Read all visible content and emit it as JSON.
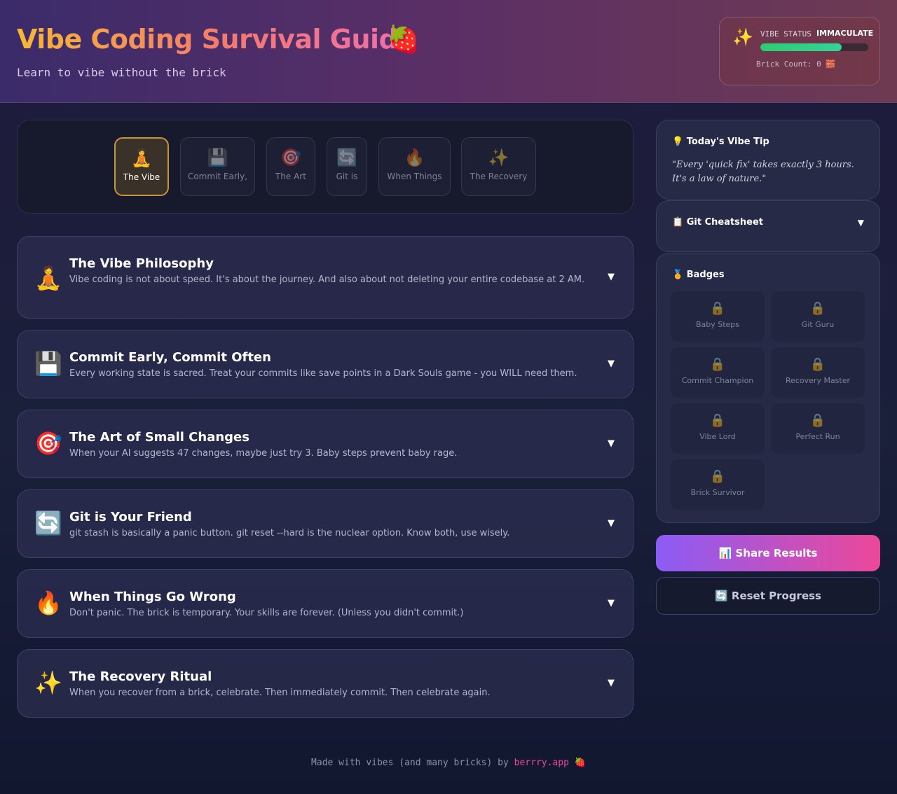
{
  "header": {
    "title": "Vibe Coding Survival Guide",
    "title_emoji": "🍓",
    "subtitle": "Learn to vibe without the brick",
    "status": {
      "icon": "✨",
      "label": "VIBE STATUS",
      "value": "IMMACULATE",
      "level": 0.75,
      "brick_count": "Brick Count: 0 🧱"
    }
  },
  "tabs": [
    {
      "icon": "🧘",
      "label": "The Vibe",
      "active": true
    },
    {
      "icon": "💾",
      "label": "Commit Early,",
      "active": false
    },
    {
      "icon": "🎯",
      "label": "The Art",
      "active": false
    },
    {
      "icon": "🔄",
      "label": "Git is",
      "active": false
    },
    {
      "icon": "🔥",
      "label": "When Things",
      "active": false
    },
    {
      "icon": "✨",
      "label": "The Recovery",
      "active": false
    }
  ],
  "sections": [
    {
      "icon": "🧘",
      "title": "The Vibe Philosophy",
      "desc": "Vibe coding is not about speed. It's about the journey. And also about not deleting your entire codebase at 2 AM.",
      "chevron": "▼"
    },
    {
      "icon": "💾",
      "title": "Commit Early, Commit Often",
      "desc": "Every working state is sacred. Treat your commits like save points in a Dark Souls game - you WILL need them.",
      "chevron": "▼"
    },
    {
      "icon": "🎯",
      "title": "The Art of Small Changes",
      "desc": "When your AI suggests 47 changes, maybe just try 3. Baby steps prevent baby rage.",
      "chevron": "▼"
    },
    {
      "icon": "🔄",
      "title": "Git is Your Friend",
      "desc": "git stash is basically a panic button. git reset --hard is the nuclear option. Know both, use wisely.",
      "chevron": "▼"
    },
    {
      "icon": "🔥",
      "title": "When Things Go Wrong",
      "desc": "Don't panic. The brick is temporary. Your skills are forever. (Unless you didn't commit.)",
      "chevron": "▼"
    },
    {
      "icon": "✨",
      "title": "The Recovery Ritual",
      "desc": "When you recover from a brick, celebrate. Then immediately commit. Then celebrate again.",
      "chevron": "▼"
    }
  ],
  "sidebar": {
    "tip": {
      "title": "💡 Today's Vibe Tip",
      "text": "\"Every 'quick fix' takes exactly 3 hours. It's a law of nature.\""
    },
    "cheatsheet": {
      "title": "📋 Git Cheatsheet",
      "chevron": "▼"
    },
    "badges": {
      "title": "🏅 Badges",
      "lock_icon": "🔒",
      "items": [
        {
          "label": "Baby Steps"
        },
        {
          "label": "Git Guru"
        },
        {
          "label": "Commit Champion"
        },
        {
          "label": "Recovery Master"
        },
        {
          "label": "Vibe Lord"
        },
        {
          "label": "Perfect Run"
        },
        {
          "label": "Brick Survivor"
        }
      ]
    },
    "share_label": "📊 Share Results",
    "reset_label": "🔄 Reset Progress"
  },
  "footer": {
    "text": "Made with vibes (and many bricks) by ",
    "link": "berrry.app",
    "emoji": "🍓"
  }
}
